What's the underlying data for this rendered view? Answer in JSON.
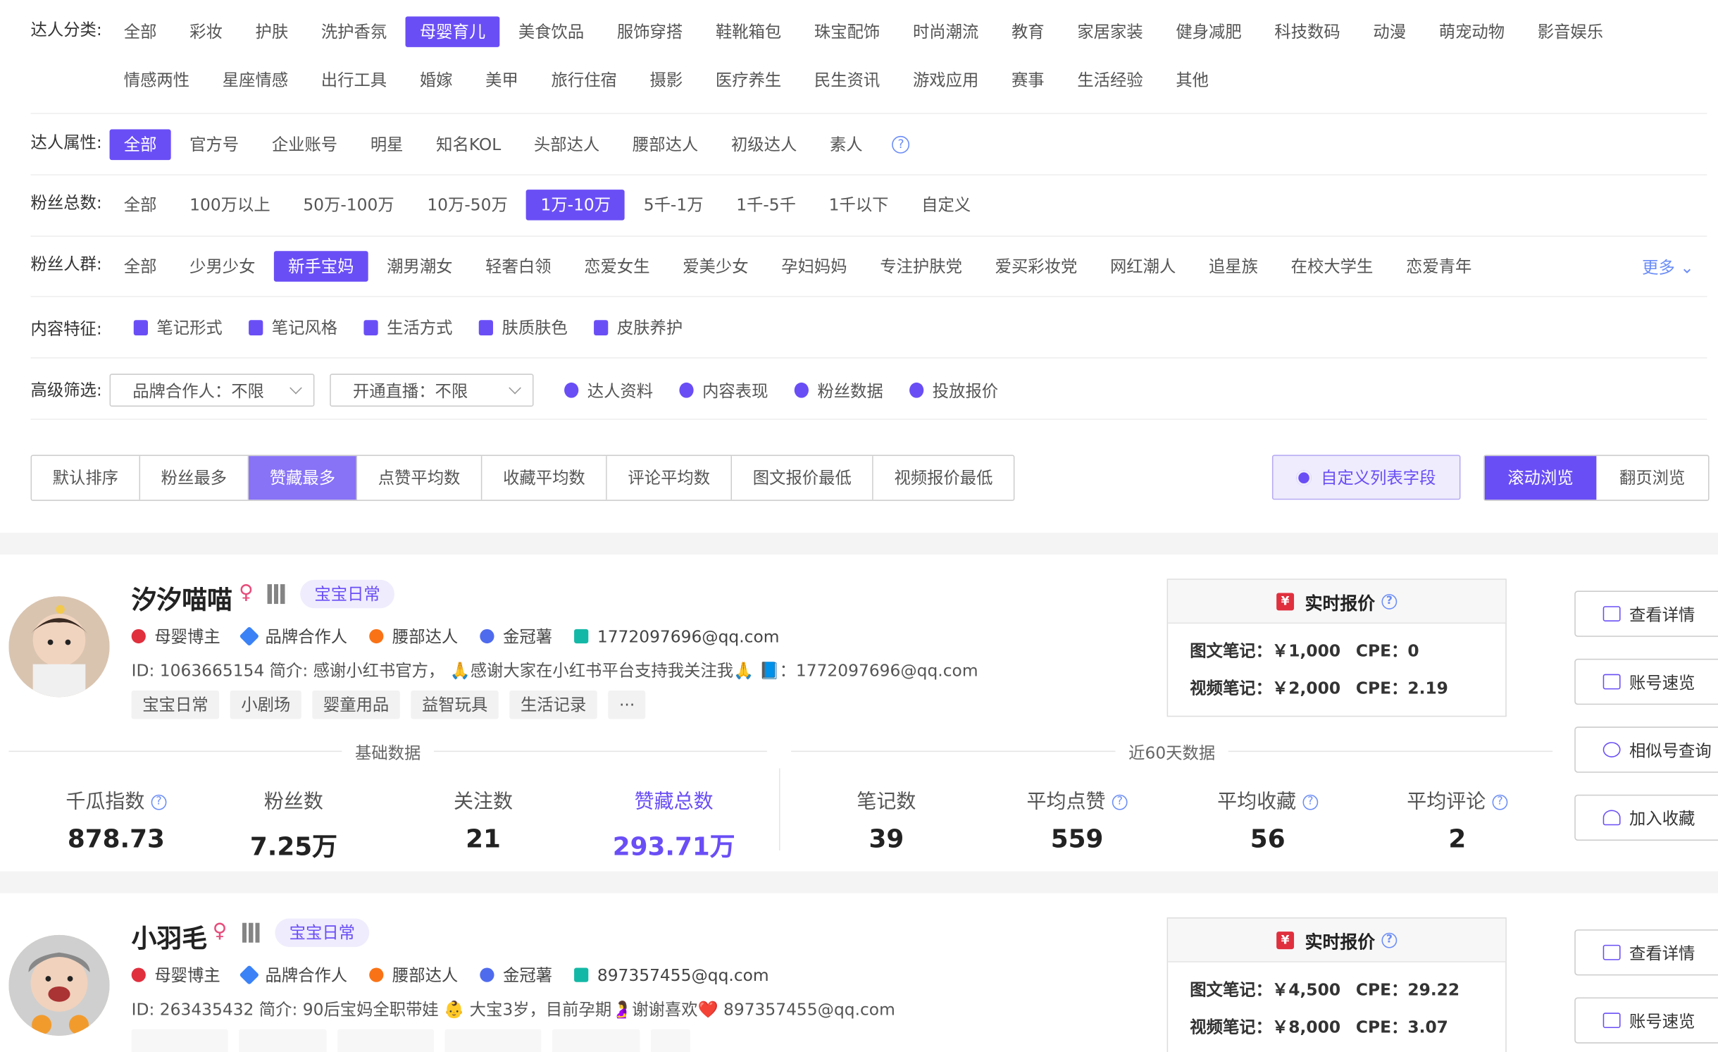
{
  "filters": {
    "category": {
      "label": "达人分类:",
      "row1": [
        "全部",
        "彩妆",
        "护肤",
        "洗护香氛",
        "母婴育儿",
        "美食饮品",
        "服饰穿搭",
        "鞋靴箱包",
        "珠宝配饰",
        "时尚潮流",
        "教育",
        "家居家装",
        "健身减肥",
        "科技数码",
        "动漫",
        "萌宠动物",
        "影音娱乐"
      ],
      "row2": [
        "情感两性",
        "星座情感",
        "出行工具",
        "婚嫁",
        "美甲",
        "旅行住宿",
        "摄影",
        "医疗养生",
        "民生资讯",
        "游戏应用",
        "赛事",
        "生活经验",
        "其他"
      ],
      "active": "母婴育儿"
    },
    "attribute": {
      "label": "达人属性:",
      "items": [
        "全部",
        "官方号",
        "企业账号",
        "明星",
        "知名KOL",
        "头部达人",
        "腰部达人",
        "初级达人",
        "素人"
      ],
      "active": "全部",
      "help": "?"
    },
    "fans_total": {
      "label": "粉丝总数:",
      "items": [
        "全部",
        "100万以上",
        "50万-100万",
        "10万-50万",
        "1万-10万",
        "5千-1万",
        "1千-5千",
        "1千以下",
        "自定义"
      ],
      "active": "1万-10万"
    },
    "fans_group": {
      "label": "粉丝人群:",
      "items": [
        "全部",
        "少男少女",
        "新手宝妈",
        "潮男潮女",
        "轻奢白领",
        "恋爱女生",
        "爱美少女",
        "孕妇妈妈",
        "专注护肤党",
        "爱买彩妆党",
        "网红潮人",
        "追星族",
        "在校大学生",
        "恋爱青年"
      ],
      "active": "新手宝妈",
      "more": "更多"
    },
    "content": {
      "label": "内容特征:",
      "items": [
        "笔记形式",
        "笔记风格",
        "生活方式",
        "肤质肤色",
        "皮肤养护"
      ]
    },
    "advanced": {
      "label": "高级筛选:",
      "select1": "品牌合作人：不限",
      "select2": "开通直播：不限",
      "links": [
        "达人资料",
        "内容表现",
        "粉丝数据",
        "投放报价"
      ]
    }
  },
  "sort": {
    "items": [
      "默认排序",
      "粉丝最多",
      "赞藏最多",
      "点赞平均数",
      "收藏平均数",
      "评论平均数",
      "图文报价最低",
      "视频报价最低"
    ],
    "active": "赞藏最多"
  },
  "custom_fields": "自定义列表字段",
  "view": {
    "items": [
      "滚动浏览",
      "翻页浏览"
    ],
    "active": "滚动浏览"
  },
  "common": {
    "price_title": "实时报价",
    "basic_title": "基础数据",
    "recent_title": "近60天数据",
    "side_buttons": [
      "查看详情",
      "账号速览",
      "相似号查询",
      "加入收藏"
    ],
    "stat_labels": [
      "千瓜指数",
      "粉丝数",
      "关注数",
      "赞藏总数",
      "笔记数",
      "平均点赞",
      "平均收藏",
      "平均评论"
    ],
    "meta_labels": [
      "母婴博主",
      "品牌合作人",
      "腰部达人",
      "金冠薯"
    ]
  },
  "kols": [
    {
      "name": "汐汐喵喵",
      "badge": "宝宝日常",
      "email": "1772097696@qq.com",
      "bio": "ID: 1063665154   简介: 感谢小红书官方，  🙏感谢大家在小红书平台支持我关注我🙏 📘：1772097696@qq.com",
      "tags": [
        "宝宝日常",
        "小剧场",
        "婴童用品",
        "益智玩具",
        "生活记录",
        "···"
      ],
      "price_image": "图文笔记：￥1,000",
      "cpe_image": "CPE：0",
      "price_video": "视频笔记：￥2,000",
      "cpe_video": "CPE：2.19",
      "stats": [
        "878.73",
        "7.25万",
        "21",
        "293.71万",
        "39",
        "559",
        "56",
        "2"
      ]
    },
    {
      "name": "小羽毛",
      "badge": "宝宝日常",
      "email": "897357455@qq.com",
      "bio": "ID: 263435432   简介: 90后宝妈全职带娃 👶 大宝3岁，目前孕期🤰谢谢喜欢❤️ 897357455@qq.com",
      "price_image": "图文笔记：￥4,500",
      "cpe_image": "CPE：29.22",
      "price_video": "视频笔记：￥8,000",
      "cpe_video": "CPE：3.07"
    }
  ]
}
